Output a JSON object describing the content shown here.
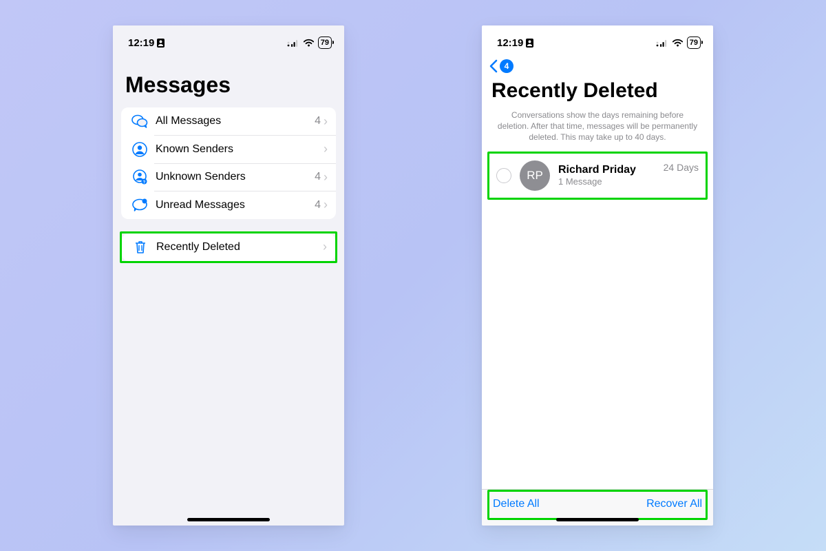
{
  "status": {
    "time": "12:19",
    "battery": "79"
  },
  "left_screen": {
    "title": "Messages",
    "rows": [
      {
        "label": "All Messages",
        "count": "4"
      },
      {
        "label": "Known Senders",
        "count": ""
      },
      {
        "label": "Unknown Senders",
        "count": "4"
      },
      {
        "label": "Unread Messages",
        "count": "4"
      }
    ],
    "recently_deleted": {
      "label": "Recently Deleted"
    }
  },
  "right_screen": {
    "back_badge": "4",
    "title": "Recently Deleted",
    "subtitle": "Conversations show the days remaining before deletion. After that time, messages will be permanently deleted. This may take up to 40 days.",
    "conversation": {
      "initials": "RP",
      "name": "Richard Priday",
      "meta": "1 Message",
      "days": "24 Days"
    },
    "toolbar": {
      "delete": "Delete All",
      "recover": "Recover All"
    }
  }
}
